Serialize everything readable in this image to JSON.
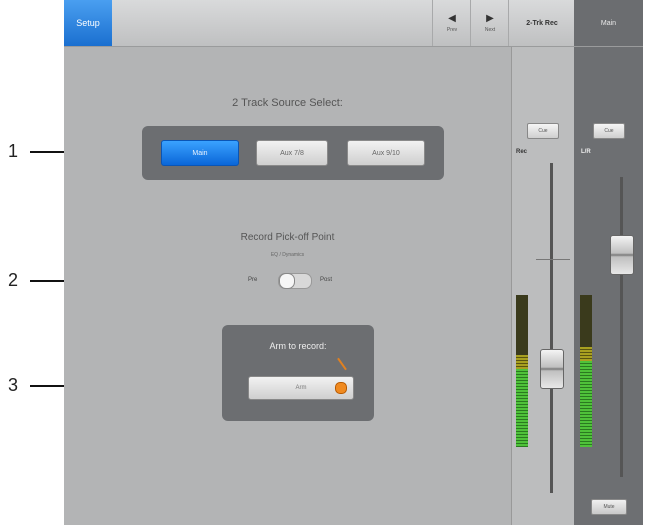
{
  "callouts": [
    "1",
    "2",
    "3"
  ],
  "topbar": {
    "setup_tab": "Setup",
    "prev_label": "Prev",
    "next_label": "Next",
    "tab_2trk": "2-Trk Rec",
    "tab_main": "Main"
  },
  "source_select": {
    "title": "2 Track Source Select:",
    "options": [
      "Main",
      "Aux 7/8",
      "Aux 9/10"
    ],
    "selected": "Main"
  },
  "pickoff": {
    "title": "Record Pick-off Point",
    "subtitle": "EQ / Dynamics",
    "pre_label": "Pre",
    "post_label": "Post",
    "state": "Pre"
  },
  "arm": {
    "title": "Arm to record:",
    "button_label": "Arm",
    "armed": false
  },
  "strip_rec": {
    "cue_label": "Cue",
    "name": "Rec"
  },
  "strip_main": {
    "cue_label": "Cue",
    "name": "L/R",
    "mute_label": "Mute"
  },
  "colors": {
    "accent": "#1a6fd0",
    "arm_led": "#f08a20",
    "meter_green": "#4fc23a"
  }
}
